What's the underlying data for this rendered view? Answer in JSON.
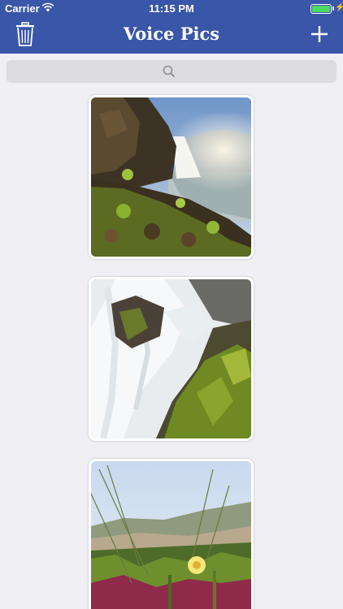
{
  "status_bar": {
    "carrier": "Carrier",
    "time": "11:15 PM",
    "battery_level": 1.0
  },
  "nav": {
    "title": "Voice Pics",
    "left_icon": "trash-icon",
    "right_icon": "plus-icon",
    "bar_color": "#3a56a8"
  },
  "search": {
    "icon": "search-icon"
  },
  "photos": [
    {
      "subject": "waterfall-cliff"
    },
    {
      "subject": "waterfall-mossy-rock"
    },
    {
      "subject": "ice-plant-flower"
    }
  ]
}
